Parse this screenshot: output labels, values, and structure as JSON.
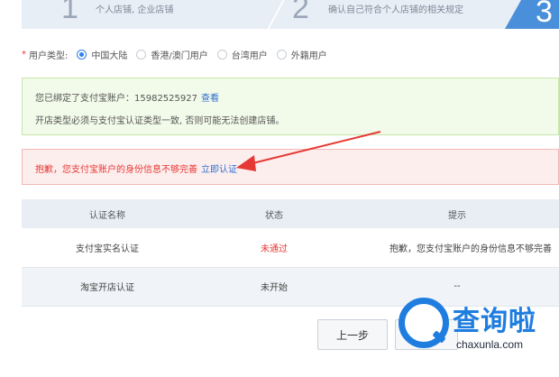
{
  "stepper": {
    "step1_number": "1",
    "step1_desc": "个人店铺, 企业店铺",
    "step2_number": "2",
    "step2_desc": "确认自己符合个人店铺的相关规定",
    "step3_number": "3"
  },
  "user_type": {
    "required_mark": "*",
    "label": "用户类型:",
    "options": [
      "中国大陆",
      "香港/澳门用户",
      "台湾用户",
      "外籍用户"
    ],
    "selected": "中国大陆"
  },
  "notice_green": {
    "line1_text": "您已绑定了支付宝账户：15982525927",
    "line1_link": "查看",
    "line2_text": "开店类型必须与支付宝认证类型一致, 否则可能无法创建店铺。"
  },
  "notice_red": {
    "text": "抱歉，您支付宝账户的身份信息不够完善",
    "link": "立即认证"
  },
  "table": {
    "headers": [
      "认证名称",
      "状态",
      "提示"
    ],
    "rows": [
      [
        "支付宝实名认证",
        "未通过",
        "抱歉，您支付宝账户的身份信息不够完善"
      ],
      [
        "淘宝开店认证",
        "未开始",
        "--"
      ]
    ]
  },
  "buttons": {
    "prev": "上一步",
    "next": ""
  },
  "watermark": {
    "title": "查询啦",
    "url": "chaxunla.com"
  },
  "colors": {
    "primary": "#2f80ed",
    "error": "#e53935",
    "watermark_blue": "#1f7de0"
  }
}
